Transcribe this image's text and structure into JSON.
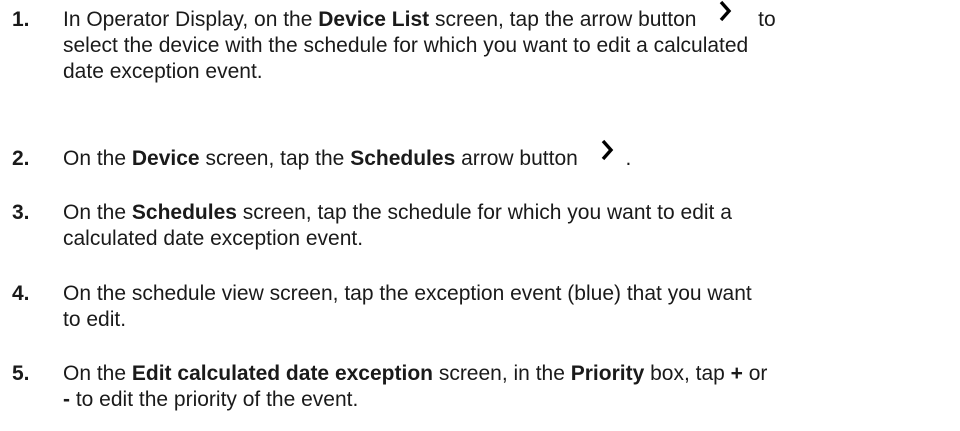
{
  "steps": [
    {
      "number": "1.",
      "parts": [
        "In Operator Display, on the ",
        "Device List",
        " screen, tap the arrow button ",
        " to",
        "select the device with the schedule for which you want to edit a calculated",
        "date exception event."
      ]
    },
    {
      "number": "2.",
      "parts": [
        "On the ",
        "Device",
        " screen, tap the ",
        "Schedules",
        " arrow button ",
        " ."
      ]
    },
    {
      "number": "3.",
      "parts": [
        "On the ",
        "Schedules",
        " screen, tap the schedule for which you want to edit a",
        "calculated date exception event."
      ]
    },
    {
      "number": "4.",
      "parts": [
        "On the schedule view screen, tap the exception event (blue) that you want",
        "to edit."
      ]
    },
    {
      "number": "5.",
      "parts": [
        "On the ",
        "Edit calculated date exception",
        " screen, in the ",
        "Priority",
        " box, tap ",
        "+",
        " or",
        "-",
        " to edit the priority of the event."
      ]
    }
  ]
}
